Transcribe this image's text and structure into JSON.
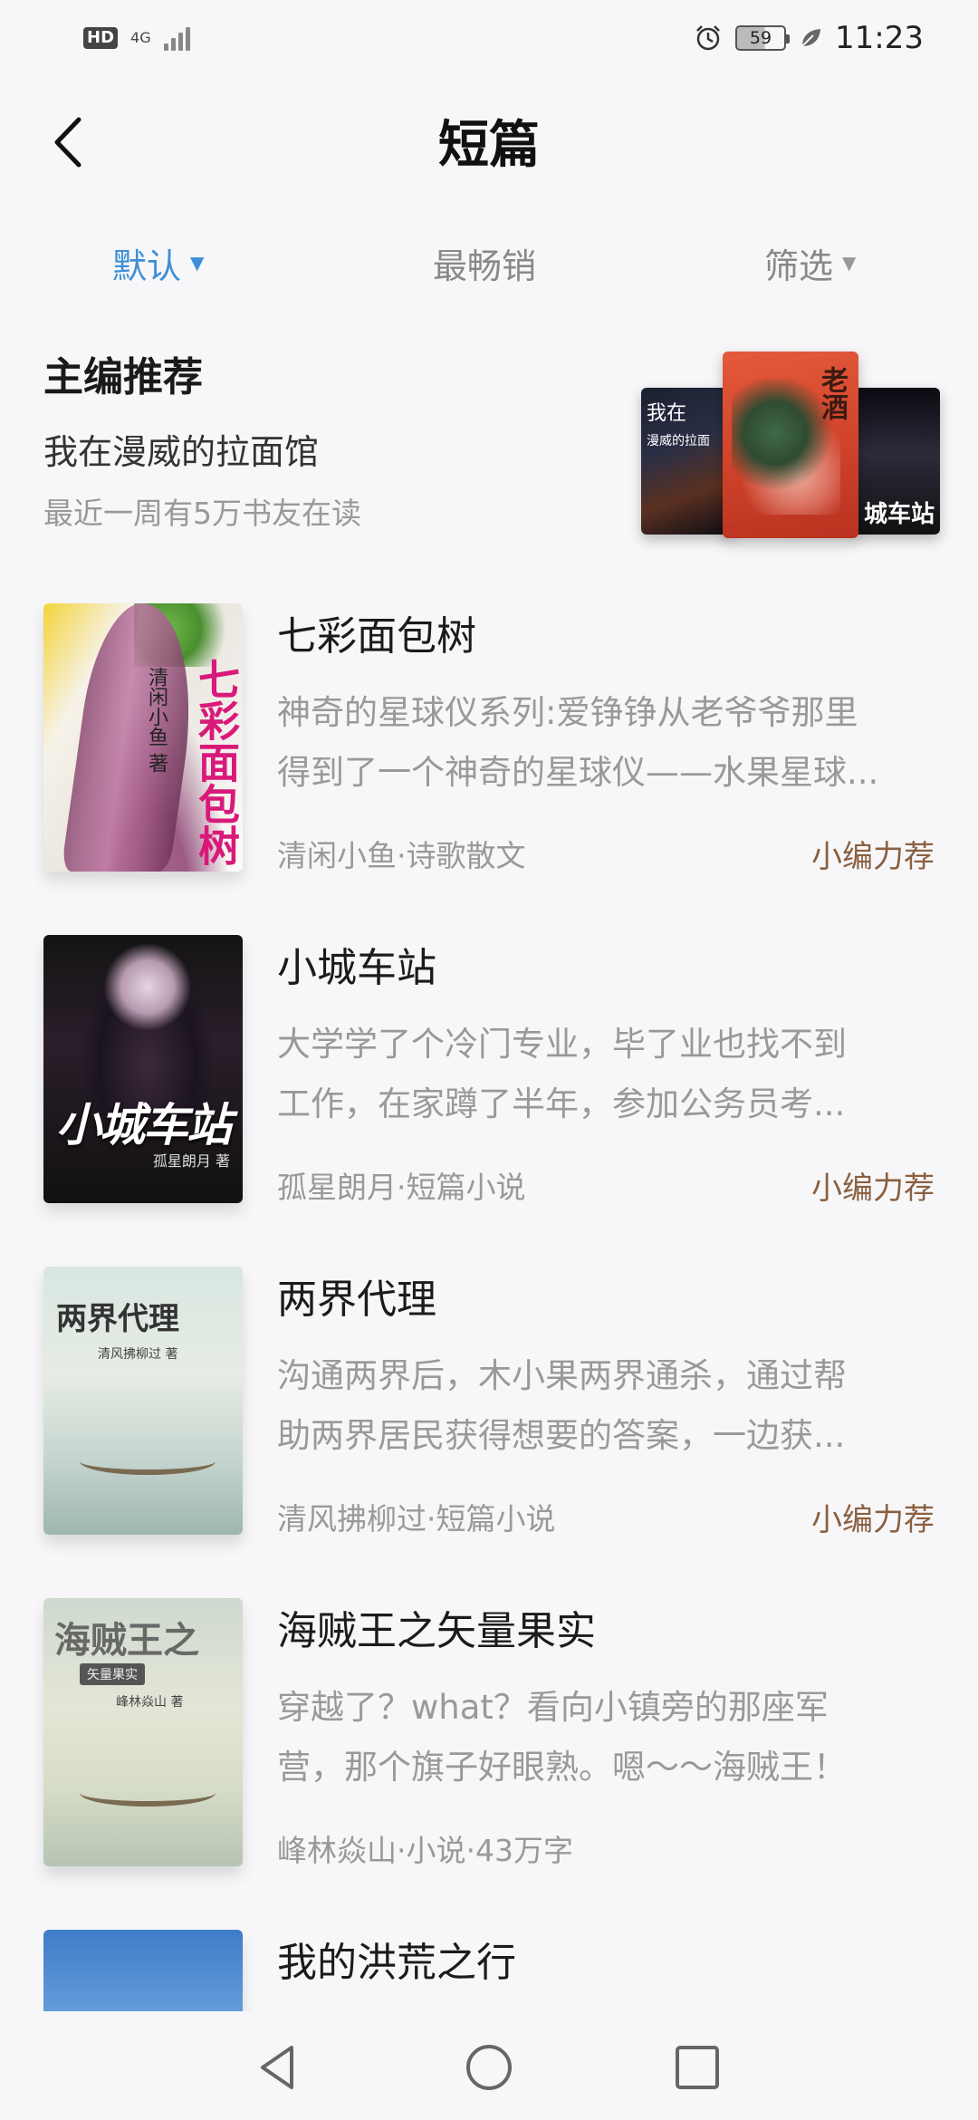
{
  "status_bar": {
    "hd": "HD",
    "network": "4G",
    "battery": "59",
    "time": "11:23"
  },
  "header": {
    "title": "短篇"
  },
  "tabs": [
    {
      "label": "默认",
      "active": true
    },
    {
      "label": "最畅销",
      "active": false
    },
    {
      "label": "筛选",
      "active": false
    }
  ],
  "editor_pick": {
    "heading": "主编推荐",
    "book_title": "我在漫威的拉面馆",
    "readers": "最近一周有5万书友在读",
    "stack_covers": {
      "left_text": "我在",
      "left_sub": "漫威的拉面",
      "center_text": "老酒",
      "right_text": "城车站"
    }
  },
  "books": [
    {
      "title": "七彩面包树",
      "desc_line1": "神奇的星球仪系列:爱铮铮从老爷爷那里",
      "desc_line2": "得到了一个神奇的星球仪——水果星球...",
      "meta": "清闲小鱼·诗歌散文",
      "tag": "小编力荐",
      "cover_title": "七彩面包树",
      "cover_author": "清闲小鱼 著"
    },
    {
      "title": "小城车站",
      "desc_line1": "大学学了个冷门专业，毕了业也找不到",
      "desc_line2": "工作，在家蹲了半年，参加公务员考...",
      "meta": "孤星朗月·短篇小说",
      "tag": "小编力荐",
      "cover_title": "小城车站",
      "cover_author": "孤星朗月 著"
    },
    {
      "title": "两界代理",
      "desc_line1": "沟通两界后，木小果两界通杀，通过帮",
      "desc_line2": "助两界居民获得想要的答案，一边获...",
      "meta": "清风拂柳过·短篇小说",
      "tag": "小编力荐",
      "cover_title": "两界代理",
      "cover_author": "清风拂柳过 著"
    },
    {
      "title": "海贼王之矢量果实",
      "desc_line1": "穿越了？what？看向小镇旁的那座军",
      "desc_line2": "营，那个旗子好眼熟。嗯～～海贼王！",
      "meta": "峰林焱山·小说·43万字",
      "tag": "",
      "cover_title": "海贼王之",
      "cover_subtitle": "矢量果实",
      "cover_author": "峰林焱山 著"
    },
    {
      "title": "我的洪荒之行",
      "desc_line1": "",
      "desc_line2": "",
      "meta": "",
      "tag": ""
    }
  ],
  "colors": {
    "accent": "#3d8fd6",
    "tag": "#8a6040",
    "muted": "#999999"
  }
}
